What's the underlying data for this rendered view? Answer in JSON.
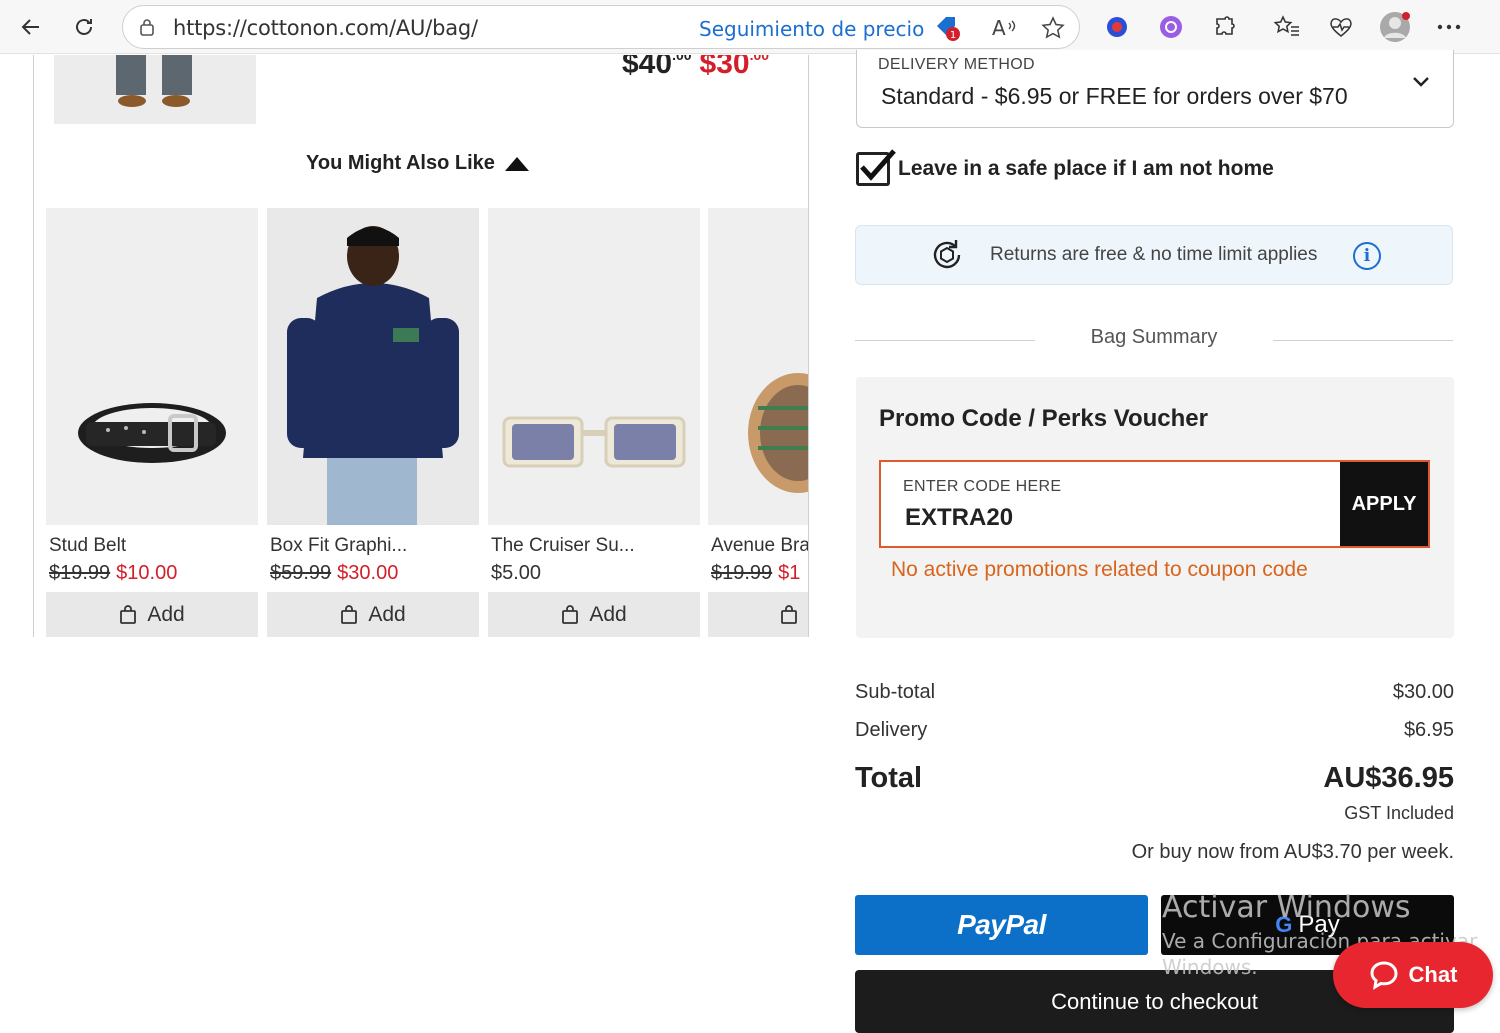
{
  "browser": {
    "url": "https://cottonon.com/AU/bag/",
    "price_tracking": "Seguimiento de precio",
    "badge_count": "1"
  },
  "cart_item": {
    "old_price_main": "$40",
    "old_price_cents": ".00",
    "new_price_main": "$30",
    "new_price_cents": ".00"
  },
  "recommendations": {
    "heading": "You Might Also Like",
    "add_label": "Add",
    "products": [
      {
        "name": "Stud Belt",
        "was": "$19.99",
        "now": "$10.00"
      },
      {
        "name": "Box Fit Graphi...",
        "was": "$59.99",
        "now": "$30.00"
      },
      {
        "name": "The Cruiser Su...",
        "price": "$5.00"
      },
      {
        "name": "Avenue Bra",
        "was": "$19.99",
        "now": "$1"
      }
    ]
  },
  "delivery": {
    "label": "DELIVERY METHOD",
    "value": "Standard - $6.95 or FREE for orders over $70"
  },
  "safe_place": {
    "label": "Leave in a safe place if I am not home",
    "checked": true
  },
  "returns": {
    "text": "Returns are free & no time limit applies"
  },
  "bag_summary": {
    "title": "Bag Summary"
  },
  "promo": {
    "heading": "Promo Code / Perks Voucher",
    "field_label": "ENTER CODE HERE",
    "field_value": "EXTRA20",
    "apply_label": "APPLY",
    "error": "No active promotions related to coupon code"
  },
  "totals": {
    "subtotal_label": "Sub-total",
    "subtotal_value": "$30.00",
    "delivery_label": "Delivery",
    "delivery_value": "$6.95",
    "total_label": "Total",
    "total_value": "AU$36.95",
    "gst": "GST Included",
    "afterpay": "Or buy now from AU$3.70 per week."
  },
  "payments": {
    "paypal": "PayPal",
    "gpay_g": "G",
    "gpay": "Pay",
    "checkout": "Continue to checkout"
  },
  "watermark": {
    "line1": "Activar Windows",
    "line2": "Ve a Configuración para activar",
    "line3": "Windows."
  },
  "chat": {
    "label": "Chat"
  },
  "colors": {
    "sale_red": "#d21f2a",
    "promo_error": "#d9641c",
    "paypal_blue": "#0c70c9",
    "chat_red": "#e8262f",
    "link_blue": "#1a6fd0"
  }
}
